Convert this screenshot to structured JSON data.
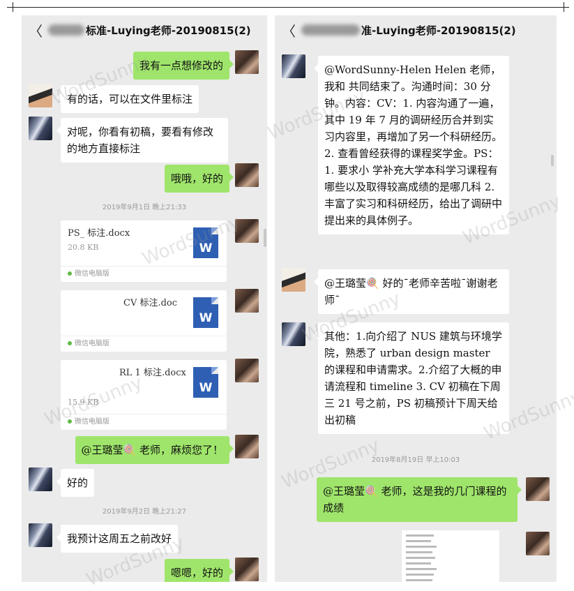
{
  "left": {
    "title": "标准-Luying老师-20190815(2)",
    "messages": {
      "m1": "我有一点想修改的",
      "m2": "有的话，可以在文件里标注",
      "m3": "对呢，你看有初稿，要看有修改的地方直接标注",
      "m4": "哦哦，好的",
      "ts1": "2019年9月1日 晚上21:33",
      "f1_name": "PS_      标注.docx",
      "f1_size": "20.8 KB",
      "f2_name": "CV 标注.doc",
      "f3_name": "RL 1 标注.docx",
      "f3_size": "15.9 KB",
      "file_source": "微信电脑版",
      "m5": "@王璐莹🍭 老师，麻烦您了！",
      "m6": "好的",
      "ts2": "2019年9月2日 晚上21:27",
      "m7": "我预计这周五之前改好",
      "m8": "嗯嗯，好的"
    }
  },
  "right": {
    "title": "准-Luying老师-20190815(2)",
    "messages": {
      "r1": "@WordSunny-Helen Helen 老师，我和      共同结束了。沟通时间：30 分钟。内容：CV：1. 内容沟通了一遍，其中 19 年 7 月的调研经历合并到实习内容里，再增加了另一个科研经历。2. 查看曾经获得的课程奖学金。PS：1. 要求小 学补充大学本科学习课程有哪些以及取得较高成绩的是哪几科 2. 丰富了实习和科研经历，给出了调研中提出来的具体例子。",
      "r2": "@王璐莹🍭 好的ˉ老师辛苦啦ˉ谢谢老师ˉ",
      "r3": "其他：1.向介绍了 NUS 建筑与环境学院，熟悉了 urban design master 的课程和申请需求。2.介绍了大概的申请流程和 timeline 3. CV 初稿在下周三 21 号之前，PS 初稿预计下周天给出初稿",
      "ts1": "2019年8月19日 早上10:03",
      "r4": "@王璐莹🍭 老师，这是我的几门课程的成绩"
    }
  },
  "icons": {
    "back": "chevron-left-icon",
    "word": "word-doc-icon",
    "back_glyph": "〈",
    "word_glyph": "W"
  },
  "watermark": "WordSunny"
}
